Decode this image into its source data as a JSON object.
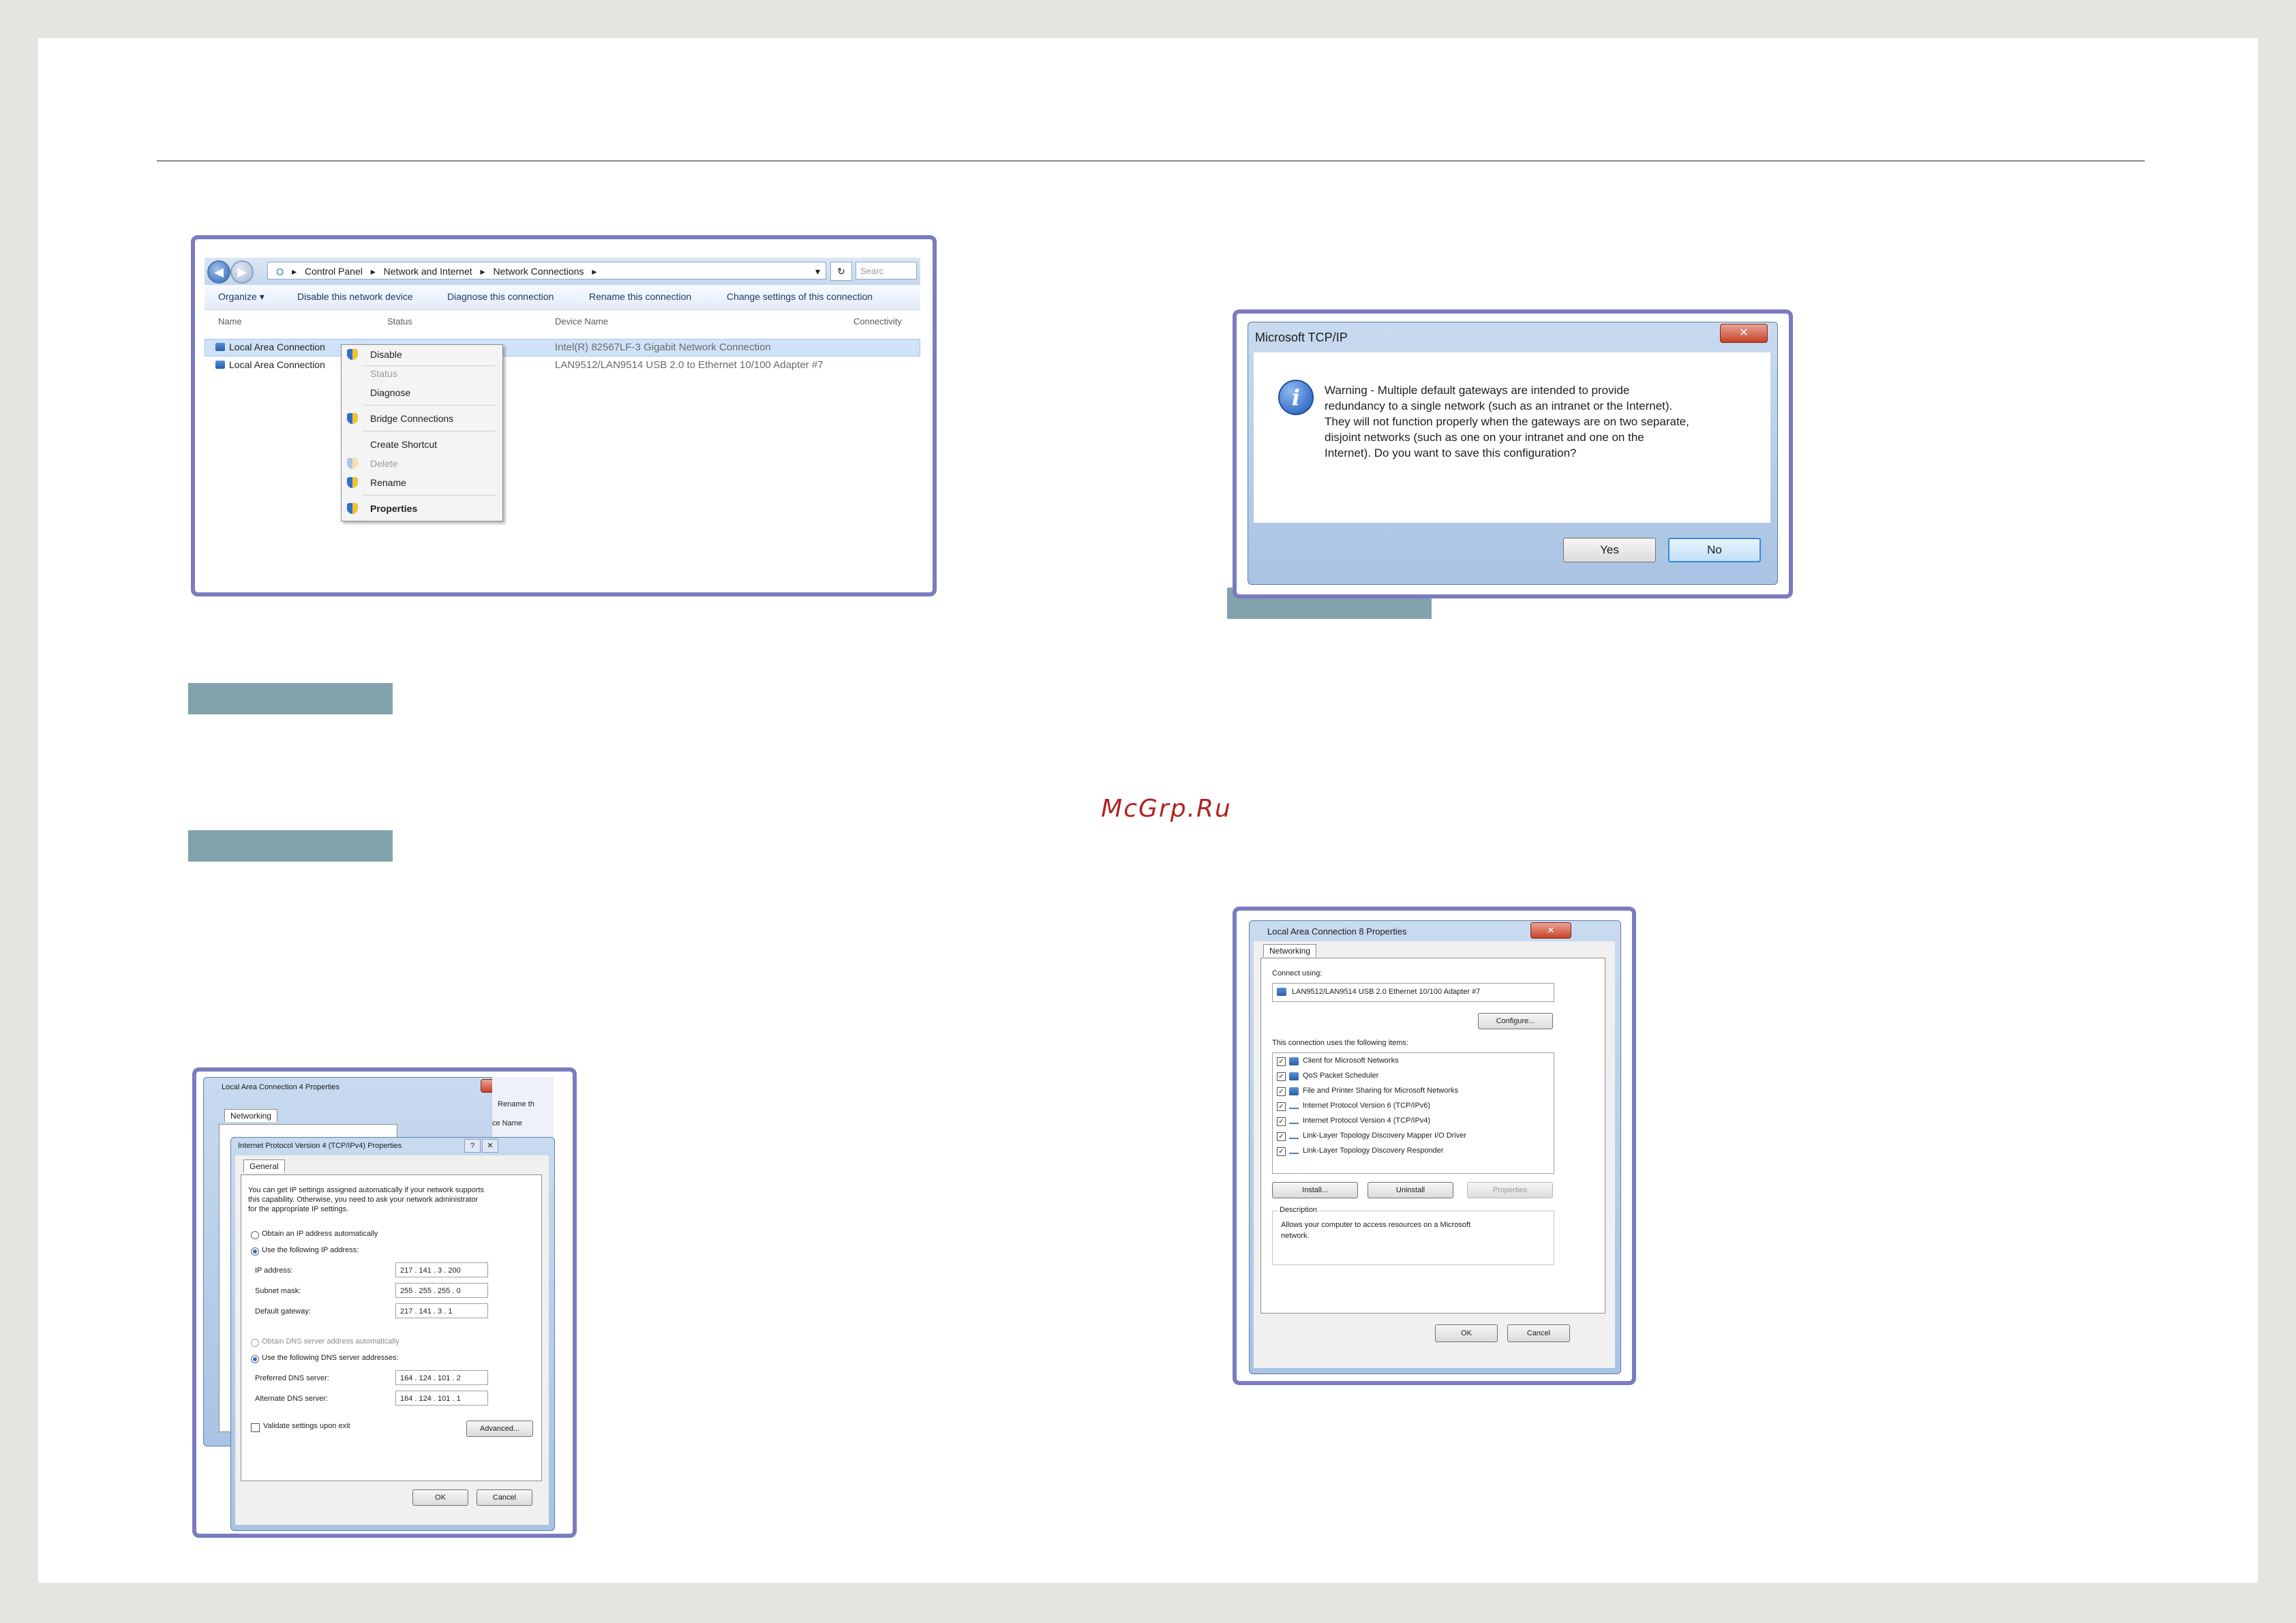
{
  "watermark": "McGrp.Ru",
  "explorer": {
    "breadcrumb": [
      "Control Panel",
      "Network and Internet",
      "Network Connections"
    ],
    "search_placeholder": "Searc",
    "commands": [
      "Organize ▾",
      "Disable this network device",
      "Diagnose this connection",
      "Rename this connection",
      "Change settings of this connection"
    ],
    "columns": [
      "Name",
      "Status",
      "Device Name",
      "Connectivity"
    ],
    "rows": [
      {
        "name": "Local Area Connection",
        "device": "Intel(R) 82567LF-3 Gigabit Network Connection"
      },
      {
        "name": "Local Area Connection",
        "device": "LAN9512/LAN9514 USB 2.0 to Ethernet 10/100 Adapter #7"
      }
    ],
    "context_menu": [
      "Disable",
      "Status",
      "Diagnose",
      "Bridge Connections",
      "Create Shortcut",
      "Delete",
      "Rename",
      "Properties"
    ]
  },
  "tcpip_warning": {
    "title": "Microsoft TCP/IP",
    "message_lines": [
      "Warning - Multiple default gateways are intended to provide",
      "redundancy to a single network (such as an intranet or the Internet).",
      "They will not function properly when the gateways are on two separate,",
      "disjoint networks (such as one on your intranet and one on the",
      "Internet). Do you want to save this configuration?"
    ],
    "yes_label": "Yes",
    "no_label": "No"
  },
  "ipv4_dialog": {
    "outer_title": "Local Area Connection 4 Properties",
    "outer_tab": "Networking",
    "behind_text": [
      "Rename th",
      "ce Name"
    ],
    "title": "Internet Protocol Version 4 (TCP/IPv4) Properties",
    "tab": "General",
    "intro_lines": [
      "You can get IP settings assigned automatically if your network supports",
      "this capability. Otherwise, you need to ask your network administrator",
      "for the appropriate IP settings."
    ],
    "obtain_ip_auto": "Obtain an IP address automatically",
    "use_following_ip": "Use the following IP address:",
    "ip_label": "IP address:",
    "ip_value": "217 . 141 .  3  . 200",
    "subnet_label": "Subnet mask:",
    "subnet_value": "255 . 255 . 255 .  0",
    "gateway_label": "Default gateway:",
    "gateway_value": "217 . 141 .  3  .  1",
    "obtain_dns_auto": "Obtain DNS server address automatically",
    "use_following_dns": "Use the following DNS server addresses:",
    "pref_dns_label": "Preferred DNS server:",
    "pref_dns_value": "164 . 124 . 101 .  2",
    "alt_dns_label": "Alternate DNS server:",
    "alt_dns_value": "164 . 124 . 101 .  1",
    "validate_label": "Validate settings upon exit",
    "advanced_label": "Advanced...",
    "ok_label": "OK",
    "cancel_label": "Cancel"
  },
  "lac8_dialog": {
    "title": "Local Area Connection 8 Properties",
    "tab": "Networking",
    "connect_using_label": "Connect using:",
    "adapter": "LAN9512/LAN9514 USB 2.0 Ethernet 10/100 Adapter #7",
    "configure_label": "Configure...",
    "items_label": "This connection uses the following items:",
    "items": [
      "Client for Microsoft Networks",
      "QoS Packet Scheduler",
      "File and Printer Sharing for Microsoft Networks",
      "Internet Protocol Version 6 (TCP/IPv6)",
      "Internet Protocol Version 4 (TCP/IPv4)",
      "Link-Layer Topology Discovery Mapper I/O Driver",
      "Link-Layer Topology Discovery Responder"
    ],
    "install_label": "Install...",
    "uninstall_label": "Uninstall",
    "properties_label": "Properties",
    "description_label": "Description",
    "description_lines": [
      "Allows your computer to access resources on a Microsoft",
      "network."
    ],
    "ok_label": "OK",
    "cancel_label": "Cancel"
  },
  "colors": {
    "accent_frame": "#7b7bbf",
    "label_bar": "#82a3ab",
    "watermark": "#b22222"
  }
}
